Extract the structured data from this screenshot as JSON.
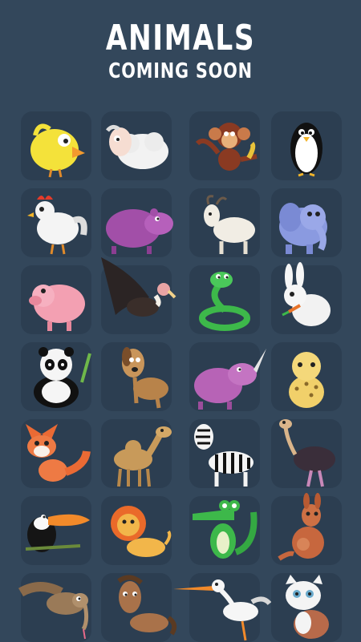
{
  "header": {
    "title": "ANIMALS",
    "subtitle": "COMING SOON"
  },
  "grid": {
    "tiles": [
      {
        "animal": "chick-icon"
      },
      {
        "animal": "sheep-icon"
      },
      {
        "animal": "monkey-icon"
      },
      {
        "animal": "penguin-icon"
      },
      {
        "animal": "rooster-icon"
      },
      {
        "animal": "hippo-icon"
      },
      {
        "animal": "goat-icon"
      },
      {
        "animal": "elephant-icon"
      },
      {
        "animal": "pig-icon"
      },
      {
        "animal": "vulture-icon"
      },
      {
        "animal": "snake-icon"
      },
      {
        "animal": "rabbit-icon"
      },
      {
        "animal": "panda-icon"
      },
      {
        "animal": "dog-icon"
      },
      {
        "animal": "rhino-icon"
      },
      {
        "animal": "leopard-icon"
      },
      {
        "animal": "fox-icon"
      },
      {
        "animal": "camel-icon"
      },
      {
        "animal": "zebra-icon"
      },
      {
        "animal": "ostrich-icon"
      },
      {
        "animal": "toucan-icon"
      },
      {
        "animal": "lion-icon"
      },
      {
        "animal": "crocodile-icon"
      },
      {
        "animal": "kangaroo-icon"
      },
      {
        "animal": "anteater-icon"
      },
      {
        "animal": "horse-icon"
      },
      {
        "animal": "stork-icon"
      },
      {
        "animal": "cat-icon"
      }
    ]
  }
}
